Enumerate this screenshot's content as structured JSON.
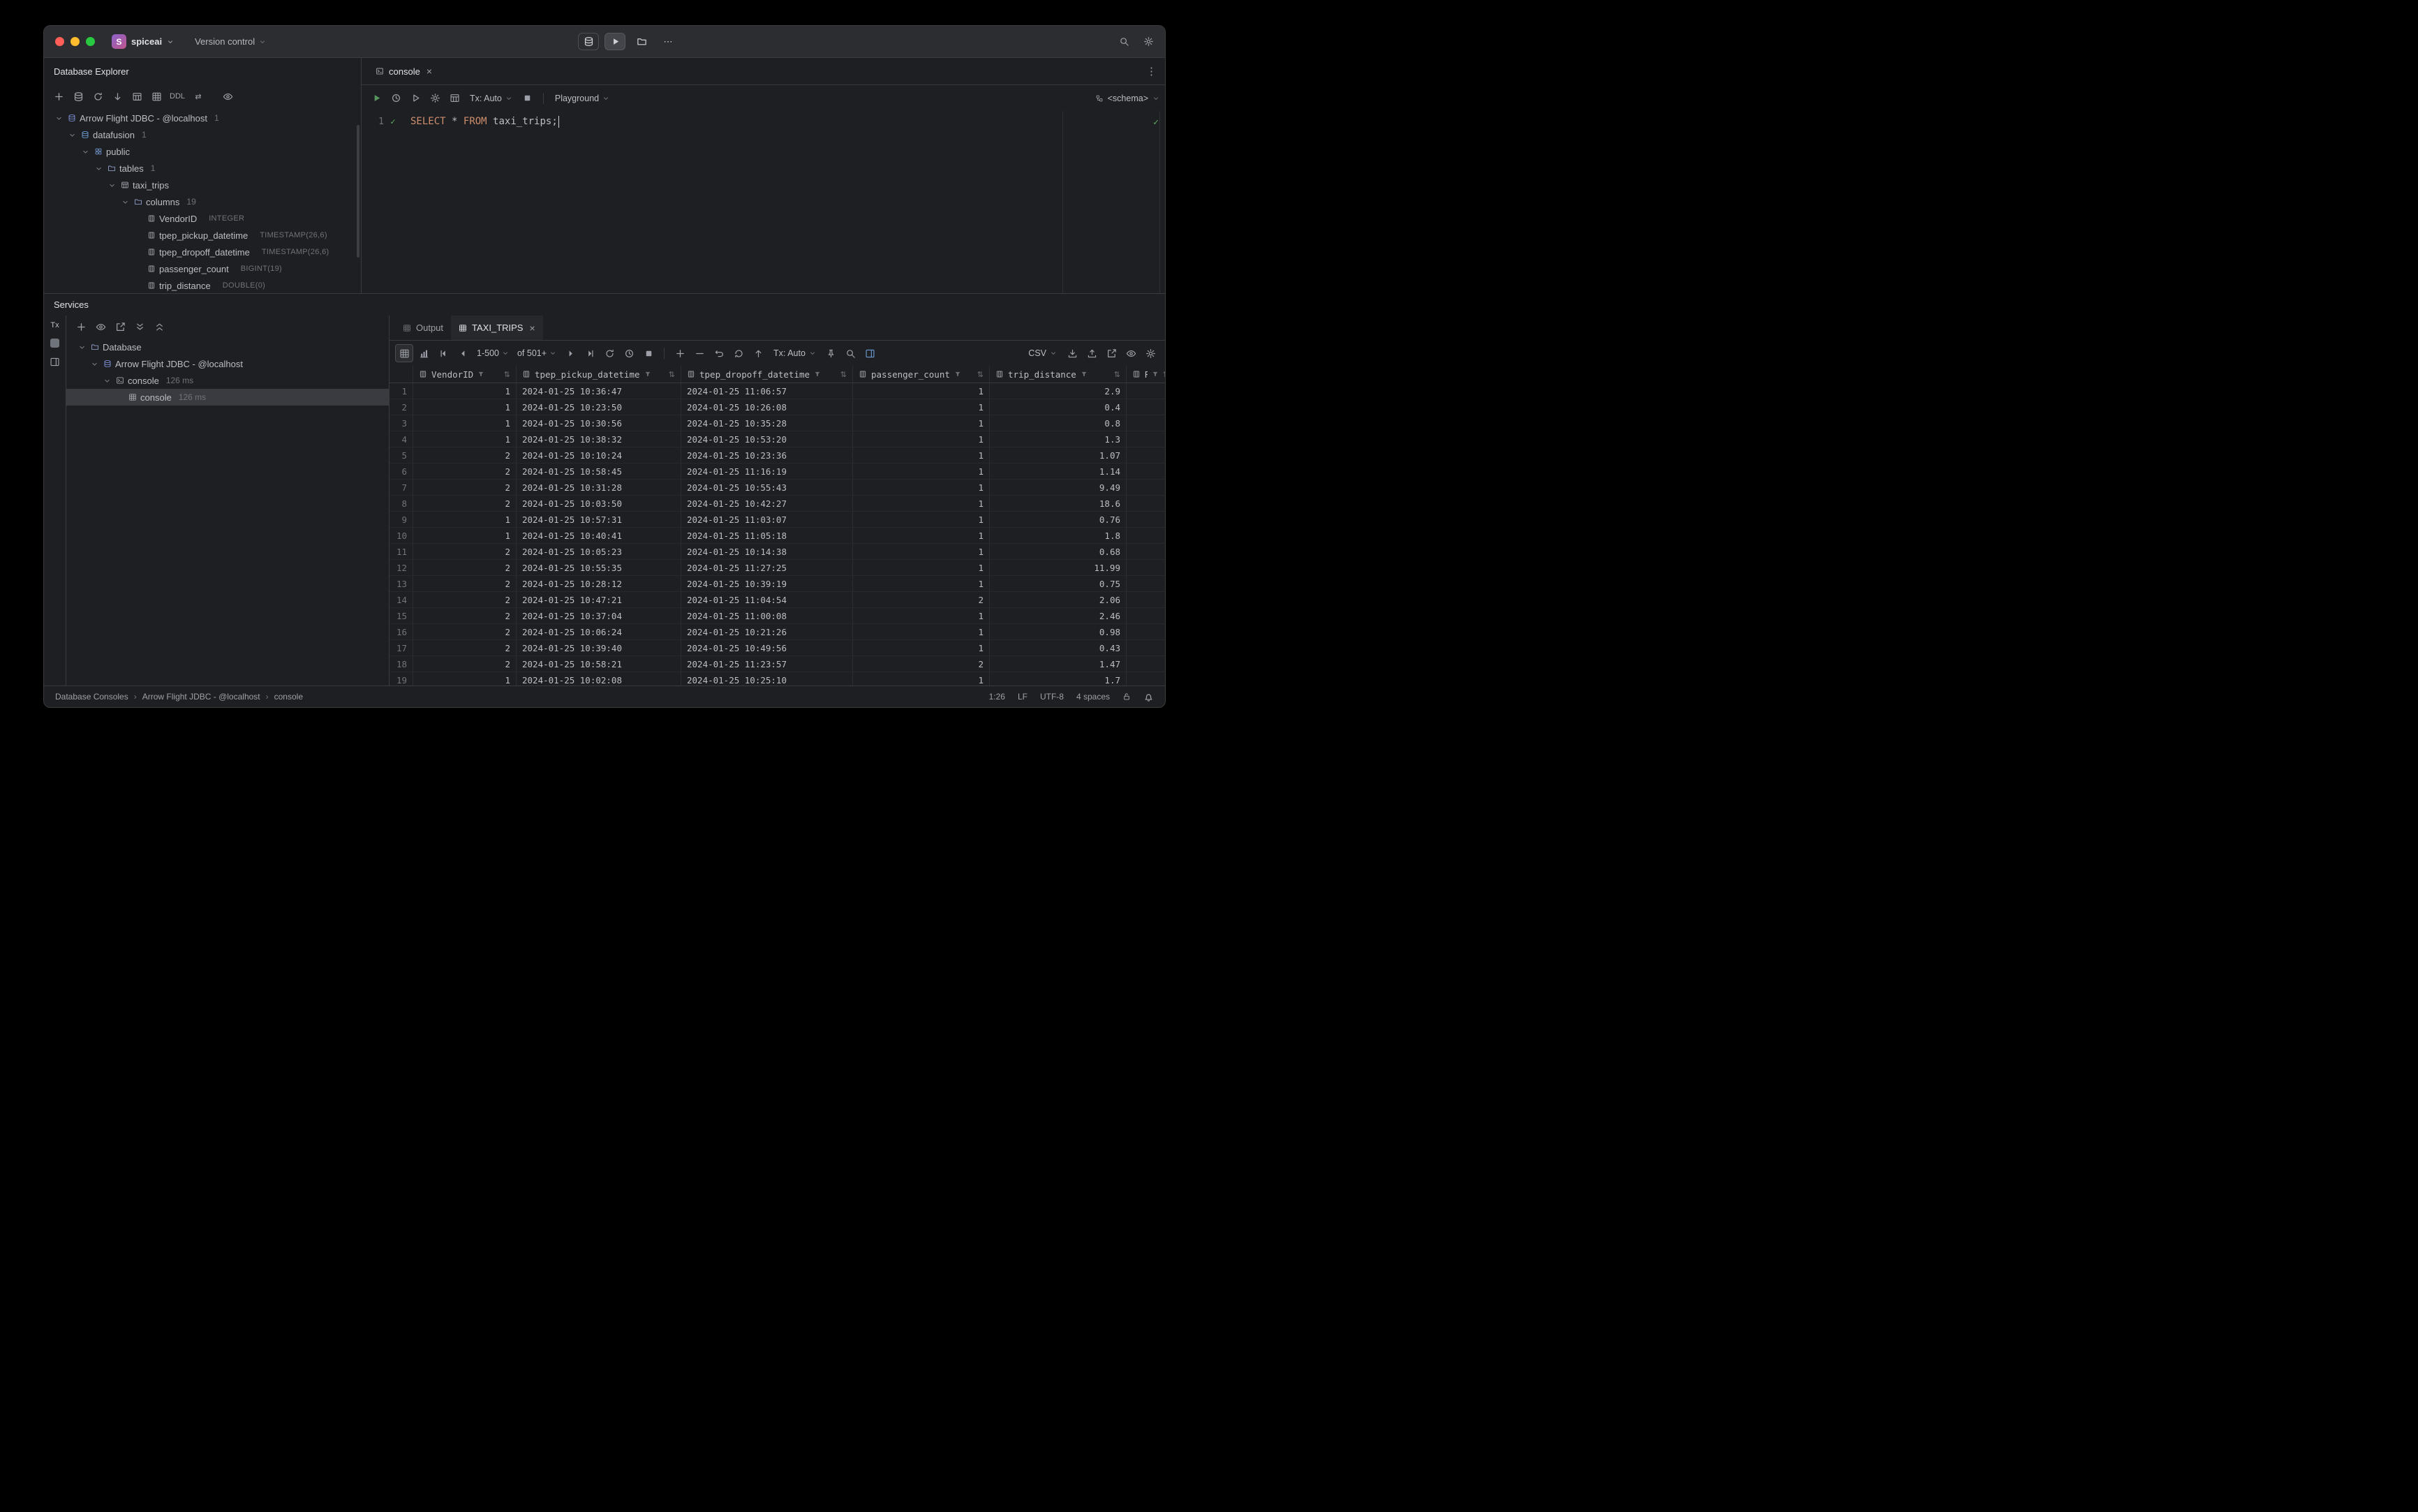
{
  "titlebar": {
    "project": "spiceai",
    "project_initial": "S",
    "version_control": "Version control"
  },
  "db_explorer": {
    "title": "Database Explorer",
    "toolbar": {
      "ddl_label": "DDL"
    },
    "tree": [
      {
        "level": 0,
        "expanded": true,
        "icon": "flight",
        "label": "Arrow Flight JDBC - @localhost",
        "meta": "1"
      },
      {
        "level": 1,
        "expanded": true,
        "icon": "db",
        "label": "datafusion",
        "meta": "1"
      },
      {
        "level": 2,
        "expanded": true,
        "icon": "schema",
        "label": "public"
      },
      {
        "level": 3,
        "expanded": true,
        "icon": "folder",
        "label": "tables",
        "meta": "1"
      },
      {
        "level": 4,
        "expanded": true,
        "icon": "table",
        "label": "taxi_trips"
      },
      {
        "level": 5,
        "expanded": true,
        "icon": "folder",
        "label": "columns",
        "meta": "19"
      },
      {
        "level": 6,
        "icon": "column",
        "label": "VendorID",
        "type": "INTEGER"
      },
      {
        "level": 6,
        "icon": "column",
        "label": "tpep_pickup_datetime",
        "type": "TIMESTAMP(26,6)"
      },
      {
        "level": 6,
        "icon": "column",
        "label": "tpep_dropoff_datetime",
        "type": "TIMESTAMP(26,6)"
      },
      {
        "level": 6,
        "icon": "column",
        "label": "passenger_count",
        "type": "BIGINT(19)"
      },
      {
        "level": 6,
        "icon": "column",
        "label": "trip_distance",
        "type": "DOUBLE(0)"
      }
    ]
  },
  "editor": {
    "tab": "console",
    "toolbar": {
      "tx": "Tx: Auto",
      "playground": "Playground",
      "schema": "<schema>"
    },
    "line_number": "1",
    "code_tokens": [
      {
        "text": "SELECT",
        "style": "kw"
      },
      {
        "text": " ",
        "style": "plain"
      },
      {
        "text": "*",
        "style": "plain"
      },
      {
        "text": " ",
        "style": "plain"
      },
      {
        "text": "FROM",
        "style": "kw"
      },
      {
        "text": " ",
        "style": "plain"
      },
      {
        "text": "taxi_trips",
        "style": "plain"
      },
      {
        "text": ";",
        "style": "plain"
      }
    ]
  },
  "services": {
    "title": "Services",
    "strip_tx": "Tx",
    "tree": [
      {
        "level": 0,
        "expanded": true,
        "icon": "folder",
        "label": "Database"
      },
      {
        "level": 1,
        "expanded": true,
        "icon": "flight",
        "label": "Arrow Flight JDBC - @localhost"
      },
      {
        "level": 2,
        "expanded": true,
        "icon": "console",
        "label": "console",
        "meta": "126 ms"
      },
      {
        "level": 3,
        "icon": "grid",
        "label": "console",
        "meta": "126 ms",
        "selected": true
      }
    ]
  },
  "results": {
    "tabs": [
      {
        "label": "Output",
        "active": false,
        "closable": false
      },
      {
        "label": "TAXI_TRIPS",
        "active": true,
        "closable": true
      }
    ],
    "pager": {
      "range": "1-500",
      "total": "of 501+"
    },
    "tx": "Tx: Auto",
    "export_format": "CSV",
    "grid": {
      "columns": [
        {
          "name": "VendorID",
          "align": "right"
        },
        {
          "name": "tpep_pickup_datetime",
          "align": "left"
        },
        {
          "name": "tpep_dropoff_datetime",
          "align": "left"
        },
        {
          "name": "passenger_count",
          "align": "right"
        },
        {
          "name": "trip_distance",
          "align": "right"
        },
        {
          "name": "Rate",
          "align": "left"
        }
      ],
      "rows": [
        [
          "1",
          "2024-01-25 10:36:47",
          "2024-01-25 11:06:57",
          "1",
          "2.9",
          ""
        ],
        [
          "1",
          "2024-01-25 10:23:50",
          "2024-01-25 10:26:08",
          "1",
          "0.4",
          ""
        ],
        [
          "1",
          "2024-01-25 10:30:56",
          "2024-01-25 10:35:28",
          "1",
          "0.8",
          ""
        ],
        [
          "1",
          "2024-01-25 10:38:32",
          "2024-01-25 10:53:20",
          "1",
          "1.3",
          ""
        ],
        [
          "2",
          "2024-01-25 10:10:24",
          "2024-01-25 10:23:36",
          "1",
          "1.07",
          ""
        ],
        [
          "2",
          "2024-01-25 10:58:45",
          "2024-01-25 11:16:19",
          "1",
          "1.14",
          ""
        ],
        [
          "2",
          "2024-01-25 10:31:28",
          "2024-01-25 10:55:43",
          "1",
          "9.49",
          ""
        ],
        [
          "2",
          "2024-01-25 10:03:50",
          "2024-01-25 10:42:27",
          "1",
          "18.6",
          ""
        ],
        [
          "1",
          "2024-01-25 10:57:31",
          "2024-01-25 11:03:07",
          "1",
          "0.76",
          ""
        ],
        [
          "1",
          "2024-01-25 10:40:41",
          "2024-01-25 11:05:18",
          "1",
          "1.8",
          ""
        ],
        [
          "2",
          "2024-01-25 10:05:23",
          "2024-01-25 10:14:38",
          "1",
          "0.68",
          ""
        ],
        [
          "2",
          "2024-01-25 10:55:35",
          "2024-01-25 11:27:25",
          "1",
          "11.99",
          ""
        ],
        [
          "2",
          "2024-01-25 10:28:12",
          "2024-01-25 10:39:19",
          "1",
          "0.75",
          ""
        ],
        [
          "2",
          "2024-01-25 10:47:21",
          "2024-01-25 11:04:54",
          "2",
          "2.06",
          ""
        ],
        [
          "2",
          "2024-01-25 10:37:04",
          "2024-01-25 11:00:08",
          "1",
          "2.46",
          ""
        ],
        [
          "2",
          "2024-01-25 10:06:24",
          "2024-01-25 10:21:26",
          "1",
          "0.98",
          ""
        ],
        [
          "2",
          "2024-01-25 10:39:40",
          "2024-01-25 10:49:56",
          "1",
          "0.43",
          ""
        ],
        [
          "2",
          "2024-01-25 10:58:21",
          "2024-01-25 11:23:57",
          "2",
          "1.47",
          ""
        ],
        [
          "1",
          "2024-01-25 10:02:08",
          "2024-01-25 10:25:10",
          "1",
          "1.7",
          ""
        ]
      ]
    }
  },
  "statusbar": {
    "breadcrumbs": [
      "Database Consoles",
      "Arrow Flight JDBC - @localhost",
      "console"
    ],
    "caret": "1:26",
    "line_ending": "LF",
    "encoding": "UTF-8",
    "indent": "4 spaces"
  }
}
